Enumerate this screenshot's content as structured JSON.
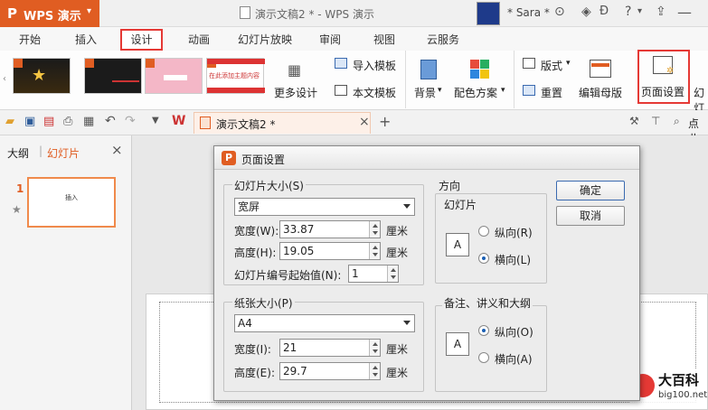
{
  "app": {
    "name": "WPS 演示",
    "document_title": "演示文稿2 * - WPS 演示",
    "user": "* Sara *"
  },
  "tabs": [
    "开始",
    "插入",
    "设计",
    "动画",
    "幻灯片放映",
    "审阅",
    "视图",
    "云服务"
  ],
  "ribbon": {
    "more_design": "更多设计",
    "import_template": "导入模板",
    "text_template": "本文模板",
    "format": "版式",
    "background": "背景",
    "color_scheme": "配色方案",
    "reset": "重置",
    "edit_master": "编辑母版",
    "page_setup": "页面设置",
    "cut_label": "幻灯",
    "thumb2_text": "",
    "thumb3_text": "",
    "thumb4_text": "在此添加主题内容"
  },
  "doc_tab": "演示文稿2 *",
  "toolbar_right": "点此",
  "left_panel": {
    "tab_outline": "大纲",
    "tab_slides": "幻灯片",
    "slide_number": "1",
    "slide_thumb_text": "插入"
  },
  "dialog": {
    "title": "页面设置",
    "slide_size_group": "幻灯片大小(S)",
    "slide_size_value": "宽屏",
    "width_label": "宽度(W):",
    "width_value": "33.87",
    "height_label": "高度(H):",
    "height_value": "19.05",
    "unit": "厘米",
    "start_number_label": "幻灯片编号起始值(N):",
    "start_number_value": "1",
    "paper_group": "纸张大小(P)",
    "paper_value": "A4",
    "paper_width_label": "宽度(I):",
    "paper_width_value": "21",
    "paper_height_label": "高度(E):",
    "paper_height_value": "29.7",
    "orientation_title": "方向",
    "slides_group": "幻灯片",
    "notes_group": "备注、讲义和大纲",
    "portrait_r": "纵向(R)",
    "landscape_l": "横向(L)",
    "portrait_o": "纵向(O)",
    "landscape_a": "横向(A)",
    "ok": "确定",
    "cancel": "取消",
    "icon_letter": "A"
  },
  "watermark": {
    "name": "大百科",
    "url": "big100.net"
  },
  "colors": {
    "wps_orange": "#e05d22",
    "highlight_red": "#e53935",
    "selection_orange": "#f08a4b"
  }
}
